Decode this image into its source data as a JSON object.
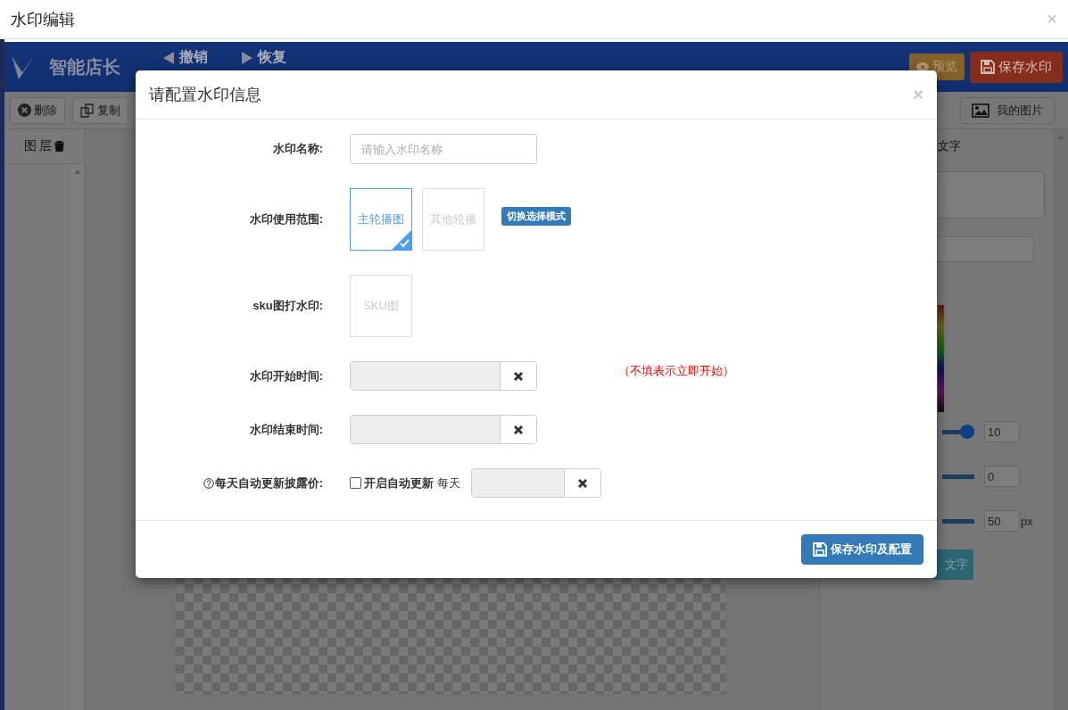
{
  "window": {
    "title": "水印编辑",
    "close": "×"
  },
  "app": {
    "brand": "智能店长",
    "history": [
      "撤销",
      "恢复"
    ],
    "header_buttons": [
      {
        "kind": "preview",
        "label": "预览"
      },
      {
        "kind": "save",
        "label": "保存水印"
      }
    ],
    "toolbar": [
      {
        "kind": "delete",
        "label": "删除"
      },
      {
        "kind": "copy",
        "label": "复制"
      },
      {
        "kind": "images",
        "label": "我的图片"
      }
    ],
    "layers_panel": {
      "title": "图 层"
    },
    "text_panel": {
      "tab": "文字",
      "sliders": [
        {
          "value": "10",
          "level": 1
        },
        {
          "value": "0"
        },
        {
          "value": "50",
          "unit": "px"
        }
      ],
      "button": "文字"
    }
  },
  "dialog": {
    "title": "请配置水印信息",
    "close": "×",
    "fields": [
      {
        "kind": "text",
        "label": "水印名称:",
        "placeholder": "请输入水印名称"
      },
      {
        "kind": "tiles",
        "label": "水印使用范围:",
        "options": [
          {
            "label": "主轮播图",
            "selected": true
          },
          {
            "label": "其他轮播",
            "selected": false
          }
        ],
        "toggle": "切换选择模式"
      },
      {
        "kind": "tiles",
        "label": "sku图打水印:",
        "options": [
          {
            "label": "SKU图",
            "selected": false
          }
        ]
      },
      {
        "kind": "date",
        "label": "水印开始时间:",
        "note": "（不填表示立即开始）"
      },
      {
        "kind": "date",
        "label": "水印结束时间:"
      },
      {
        "kind": "auto",
        "label": "每天自动更新披露价:",
        "help": true,
        "checkbox": {
          "label": "开启自动更新",
          "checked": false
        },
        "suffix": "每天"
      }
    ],
    "save_button": "保存水印及配置"
  }
}
